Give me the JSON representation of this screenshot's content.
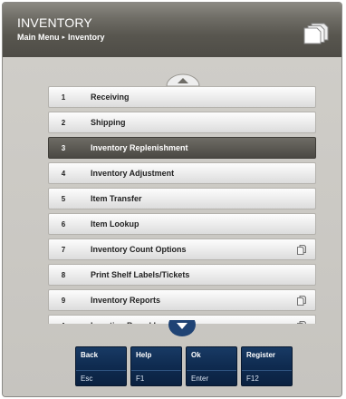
{
  "header": {
    "title": "INVENTORY",
    "breadcrumb": [
      "Main Menu",
      "Inventory"
    ],
    "breadcrumb_separator": "▸",
    "right_icon": "documents-icon"
  },
  "menu": {
    "scroll_up_icon": "chevron-up-icon",
    "scroll_down_icon": "chevron-down-icon",
    "selected_index": 2,
    "items": [
      {
        "num": "1",
        "label": "Receiving",
        "has_submenu": false
      },
      {
        "num": "2",
        "label": "Shipping",
        "has_submenu": false
      },
      {
        "num": "3",
        "label": "Inventory Replenishment",
        "has_submenu": false
      },
      {
        "num": "4",
        "label": "Inventory Adjustment",
        "has_submenu": false
      },
      {
        "num": "5",
        "label": "Item Transfer",
        "has_submenu": false
      },
      {
        "num": "6",
        "label": "Item Lookup",
        "has_submenu": false
      },
      {
        "num": "7",
        "label": "Inventory Count Options",
        "has_submenu": true
      },
      {
        "num": "8",
        "label": "Print Shelf Labels/Tickets",
        "has_submenu": false
      },
      {
        "num": "9",
        "label": "Inventory Reports",
        "has_submenu": true
      },
      {
        "num": "A",
        "label": "Location Based Inventory",
        "has_submenu": true
      }
    ]
  },
  "function_keys": [
    {
      "label": "Back",
      "key": "Esc"
    },
    {
      "label": "Help",
      "key": "F1"
    },
    {
      "label": "Ok",
      "key": "Enter"
    },
    {
      "label": "Register",
      "key": "F12"
    }
  ],
  "colors": {
    "header": "#58564f",
    "selected_row": "#4a4843",
    "function_key": "#0f2b50",
    "background": "#c9c7c2"
  }
}
